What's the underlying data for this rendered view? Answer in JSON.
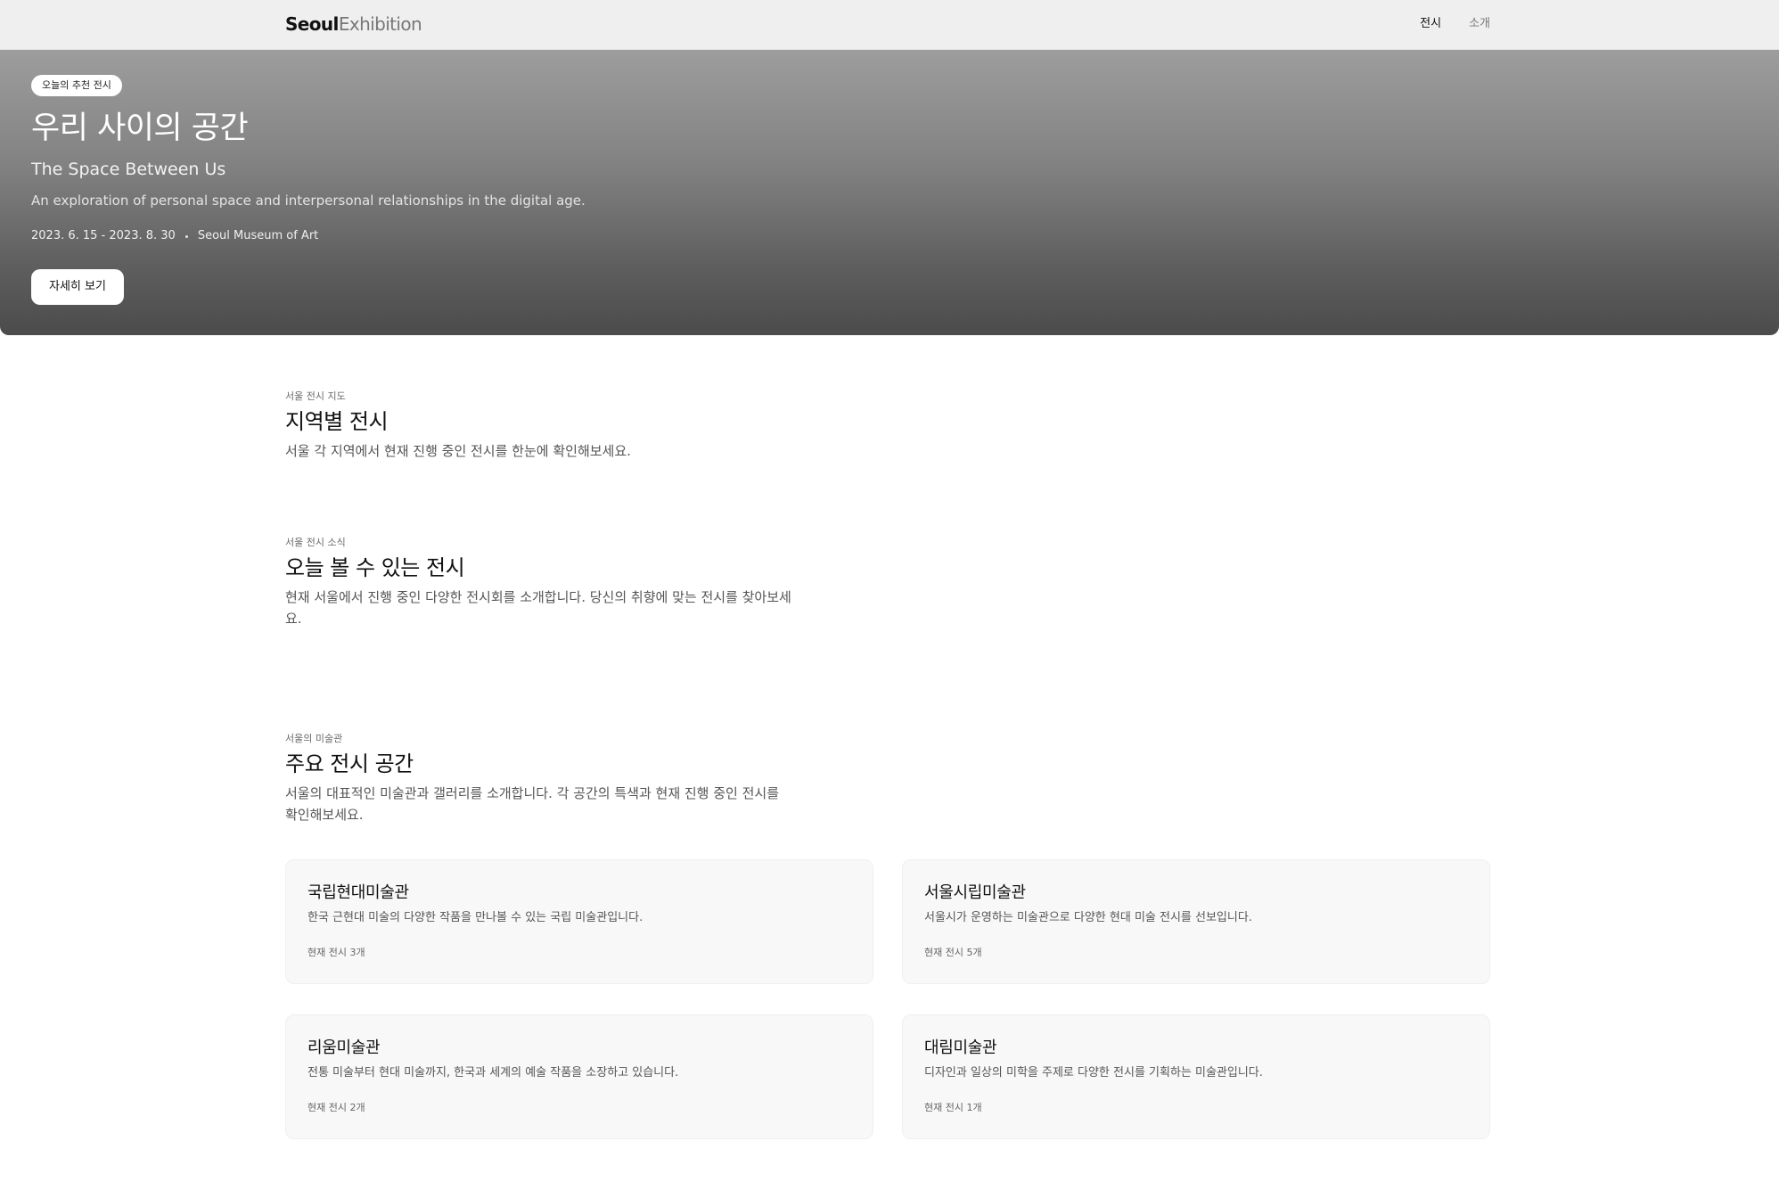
{
  "header": {
    "logo_primary": "Seoul",
    "logo_secondary": "Exhibition",
    "nav": {
      "exhibitions": "전시",
      "about": "소개"
    }
  },
  "hero": {
    "badge": "오늘의 추천 전시",
    "title": "우리 사이의 공간",
    "subtitle": "The Space Between Us",
    "description": "An exploration of personal space and interpersonal relationships in the digital age.",
    "dates": "2023. 6. 15 - 2023. 8. 30",
    "venue": "Seoul Museum of Art",
    "button_label": "자세히 보기"
  },
  "map_section": {
    "eyebrow": "서울 전시 지도",
    "title": "지역별 전시",
    "description": "서울 각 지역에서 현재 진행 중인 전시를 한눈에 확인해보세요."
  },
  "today_section": {
    "eyebrow": "서울 전시 소식",
    "title": "오늘 볼 수 있는 전시",
    "description": "현재 서울에서 진행 중인 다양한 전시회를 소개합니다. 당신의 취향에 맞는 전시를 찾아보세요."
  },
  "venues_section": {
    "eyebrow": "서울의 미술관",
    "title": "주요 전시 공간",
    "description": "서울의 대표적인 미술관과 갤러리를 소개합니다. 각 공간의 특색과 현재 진행 중인 전시를 확인해보세요.",
    "venues": [
      {
        "name": "국립현대미술관",
        "description": "한국 근현대 미술의 다양한 작품을 만나볼 수 있는 국립 미술관입니다.",
        "count": "현재 전시 3개"
      },
      {
        "name": "서울시립미술관",
        "description": "서울시가 운영하는 미술관으로 다양한 현대 미술 전시를 선보입니다.",
        "count": "현재 전시 5개"
      },
      {
        "name": "리움미술관",
        "description": "전통 미술부터 현대 미술까지, 한국과 세계의 예술 작품을 소장하고 있습니다.",
        "count": "현재 전시 2개"
      },
      {
        "name": "대림미술관",
        "description": "디자인과 일상의 미학을 주제로 다양한 전시를 기획하는 미술관입니다.",
        "count": "현재 전시 1개"
      }
    ]
  }
}
